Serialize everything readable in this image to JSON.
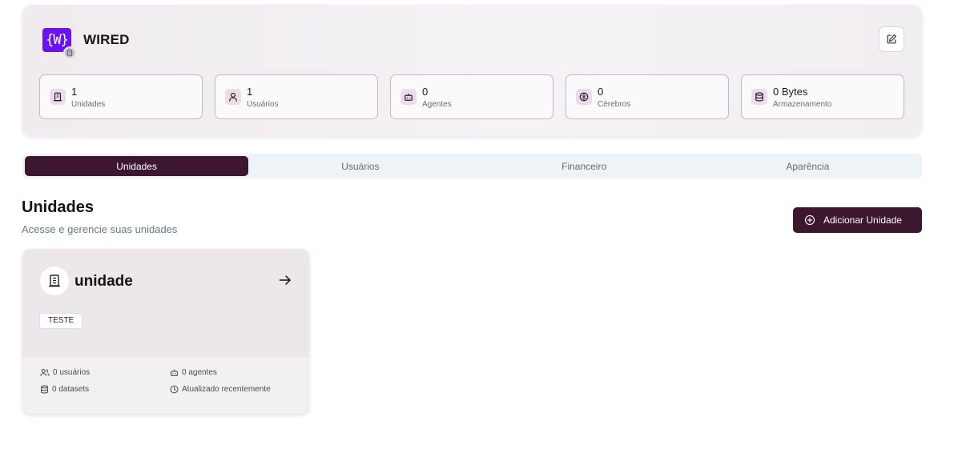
{
  "org": {
    "logo_text": "{W}",
    "name": "WIRED",
    "edit_icon": "edit-icon"
  },
  "stats": [
    {
      "value": "1",
      "label": "Unidades",
      "icon": "building-icon"
    },
    {
      "value": "1",
      "label": "Usuários",
      "icon": "user-icon"
    },
    {
      "value": "0",
      "label": "Agentes",
      "icon": "bot-icon"
    },
    {
      "value": "0",
      "label": "Cérebros",
      "icon": "brain-icon"
    },
    {
      "value": "0 Bytes",
      "label": "Armazenamento",
      "icon": "database-icon"
    }
  ],
  "tabs": [
    {
      "label": "Unidades",
      "active": true
    },
    {
      "label": "Usuários",
      "active": false
    },
    {
      "label": "Financeiro",
      "active": false
    },
    {
      "label": "Aparência",
      "active": false
    }
  ],
  "section": {
    "title": "Unidades",
    "subtitle": "Acesse e gerencie suas unidades",
    "add_button_label": "Adicionar Unidade"
  },
  "unit_card": {
    "name": "unidade",
    "tag": "TESTE",
    "users": "0 usuários",
    "agents": "0 agentes",
    "datasets": "0 datasets",
    "updated": "Atualizado recentemente"
  },
  "colors": {
    "accent": "#3d1630",
    "logo_bg": "#6b12f5",
    "stat_border": "#c9b3c4",
    "tab_bg": "#eef3f8"
  }
}
